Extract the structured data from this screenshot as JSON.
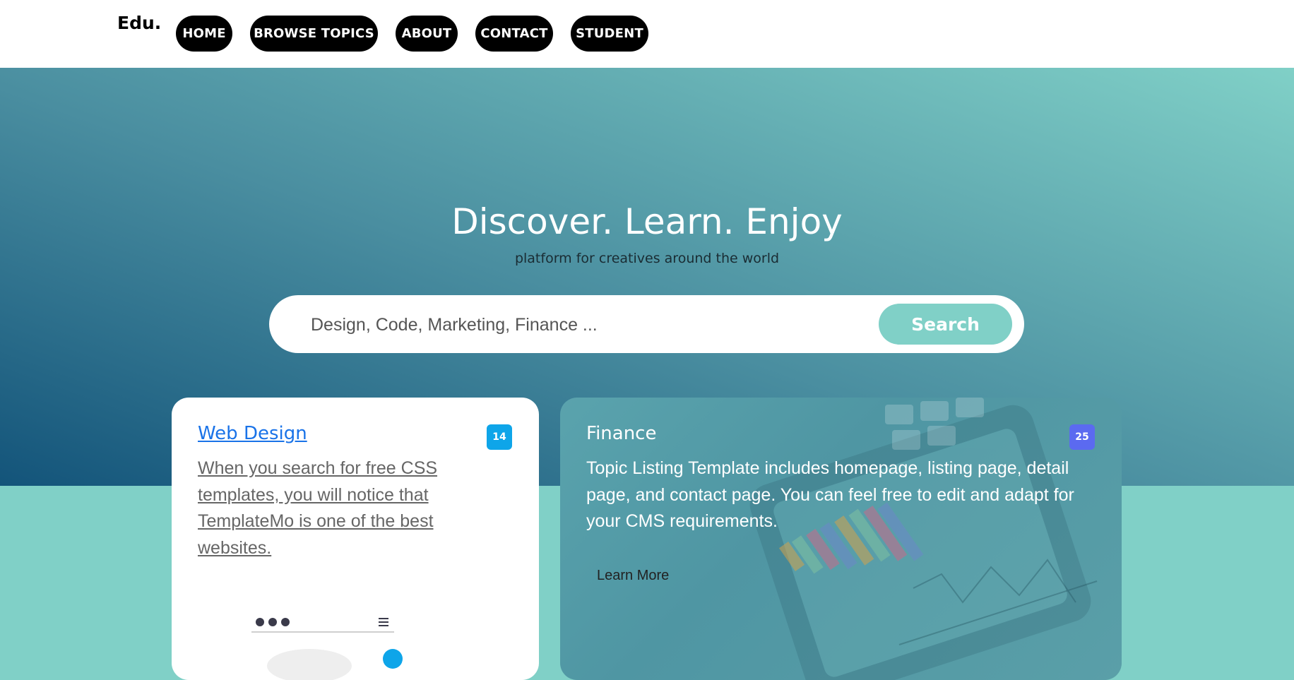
{
  "brand": "Edu.",
  "nav": [
    {
      "label": "HOME"
    },
    {
      "label": "BROWSE TOPICS"
    },
    {
      "label": "ABOUT"
    },
    {
      "label": "CONTACT"
    },
    {
      "label": "STUDENT"
    }
  ],
  "hero": {
    "title": "Discover. Learn. Enjoy",
    "subtitle": "platform for creatives around the world",
    "search_placeholder": "Design, Code, Marketing, Finance ...",
    "search_button": "Search"
  },
  "cards": {
    "web_design": {
      "title": "Web Design",
      "badge": "14",
      "badge_color": "#0ea5e9",
      "text": "When you search for free CSS templates, you will notice that TemplateMo is one of the best websites."
    },
    "finance": {
      "title": "Finance",
      "badge": "25",
      "badge_color": "#5b6af0",
      "text": "Topic Listing Template includes homepage, listing page, detail page, and contact page. You can feel free to edit and adapt for your CMS requirements.",
      "link": "Learn More"
    }
  },
  "colors": {
    "accent": "#80d0c7",
    "hero_dark": "#13547a",
    "nav_button": "#000000"
  }
}
